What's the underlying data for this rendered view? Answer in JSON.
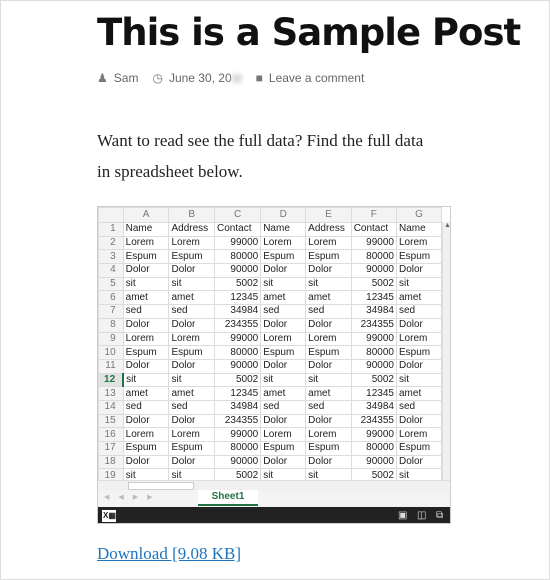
{
  "post": {
    "title": "This is a Sample Post",
    "author": "Sam",
    "date": "June 30, 20",
    "comment": "Leave a comment",
    "intro": "Want to read see the full data? Find the full data in spreadsheet below.",
    "download": "Download [9.08 KB]"
  },
  "sheet": {
    "columns": [
      "A",
      "B",
      "C",
      "D",
      "E",
      "F",
      "G"
    ],
    "selected_row": 12,
    "rows": [
      [
        "1",
        "Name",
        "Address",
        "Contact",
        "Name",
        "Address",
        "Contact",
        "Name"
      ],
      [
        "2",
        "Lorem",
        "Lorem",
        "99000",
        "Lorem",
        "Lorem",
        "99000",
        "Lorem"
      ],
      [
        "3",
        "Espum",
        "Espum",
        "80000",
        "Espum",
        "Espum",
        "80000",
        "Espum"
      ],
      [
        "4",
        "Dolor",
        "Dolor",
        "90000",
        "Dolor",
        "Dolor",
        "90000",
        "Dolor"
      ],
      [
        "5",
        "sit",
        "sit",
        "5002",
        "sit",
        "sit",
        "5002",
        "sit"
      ],
      [
        "6",
        "amet",
        "amet",
        "12345",
        "amet",
        "amet",
        "12345",
        "amet"
      ],
      [
        "7",
        "sed",
        "sed",
        "34984",
        "sed",
        "sed",
        "34984",
        "sed"
      ],
      [
        "8",
        "Dolor",
        "Dolor",
        "234355",
        "Dolor",
        "Dolor",
        "234355",
        "Dolor"
      ],
      [
        "9",
        "Lorem",
        "Lorem",
        "99000",
        "Lorem",
        "Lorem",
        "99000",
        "Lorem"
      ],
      [
        "10",
        "Espum",
        "Espum",
        "80000",
        "Espum",
        "Espum",
        "80000",
        "Espum"
      ],
      [
        "11",
        "Dolor",
        "Dolor",
        "90000",
        "Dolor",
        "Dolor",
        "90000",
        "Dolor"
      ],
      [
        "12",
        "sit",
        "sit",
        "5002",
        "sit",
        "sit",
        "5002",
        "sit"
      ],
      [
        "13",
        "amet",
        "amet",
        "12345",
        "amet",
        "amet",
        "12345",
        "amet"
      ],
      [
        "14",
        "sed",
        "sed",
        "34984",
        "sed",
        "sed",
        "34984",
        "sed"
      ],
      [
        "15",
        "Dolor",
        "Dolor",
        "234355",
        "Dolor",
        "Dolor",
        "234355",
        "Dolor"
      ],
      [
        "16",
        "Lorem",
        "Lorem",
        "99000",
        "Lorem",
        "Lorem",
        "99000",
        "Lorem"
      ],
      [
        "17",
        "Espum",
        "Espum",
        "80000",
        "Espum",
        "Espum",
        "80000",
        "Espum"
      ],
      [
        "18",
        "Dolor",
        "Dolor",
        "90000",
        "Dolor",
        "Dolor",
        "90000",
        "Dolor"
      ],
      [
        "19",
        "sit",
        "sit",
        "5002",
        "sit",
        "sit",
        "5002",
        "sit"
      ]
    ],
    "sheet_tab": "Sheet1",
    "accent": "#217346"
  }
}
